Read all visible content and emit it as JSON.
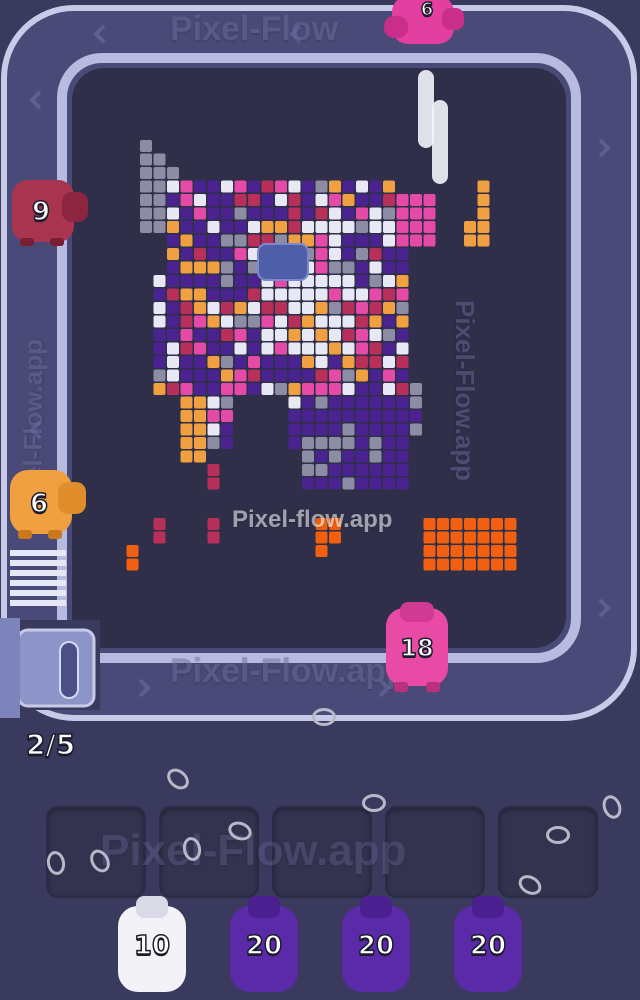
{
  "watermark": {
    "center_text": "Pixel-flow.app",
    "track_top_text": "Pixel-Flow",
    "track_bottom_text": "Pixel-Flow.app",
    "track_side_text": "Pixel-Flow.app",
    "slot_text": "Pixel-Flow.app"
  },
  "counter": {
    "text": "2/5"
  },
  "track_pigs": [
    {
      "id": "pink-top",
      "value": "6",
      "color": "#e23fa0"
    },
    {
      "id": "maroon-left",
      "value": "9",
      "color": "#a8344f"
    },
    {
      "id": "orange-left",
      "value": "6",
      "color": "#f0a040"
    },
    {
      "id": "magenta-right",
      "value": "18",
      "color": "#e84aa6"
    }
  ],
  "queue_pigs": [
    {
      "id": "white",
      "value": "10",
      "color": "#f2f2f7"
    },
    {
      "id": "purple-1",
      "value": "20",
      "color": "#5a2aa8"
    },
    {
      "id": "purple-2",
      "value": "20",
      "color": "#5a2aa8"
    },
    {
      "id": "purple-3",
      "value": "20",
      "color": "#5a2aa8"
    }
  ],
  "slots": {
    "count": 5
  },
  "colors": {
    "background": "#3a3a5e",
    "track": "#9ea2d8",
    "board": "#2f2f4a",
    "purple": "#4a2390",
    "white": "#e8e8f5",
    "pink": "#e54aa6",
    "orange": "#f0a040",
    "maroon": "#b8305a",
    "gray": "#8c8ca4",
    "red_orange": "#f06010"
  }
}
